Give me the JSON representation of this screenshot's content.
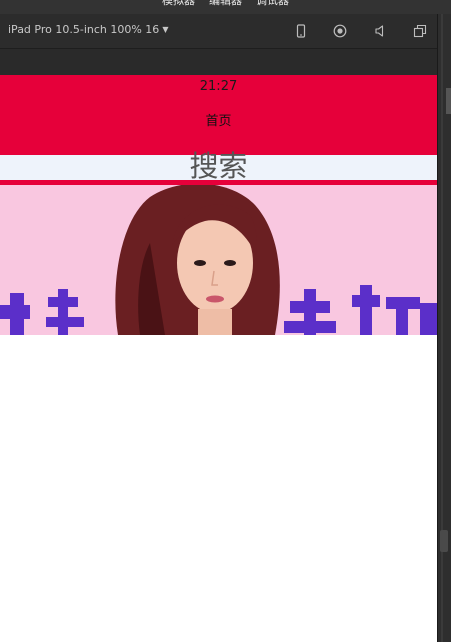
{
  "top_menu": {
    "items": [
      "模拟器",
      "编辑器",
      "调试器"
    ]
  },
  "toolbar": {
    "device_label": "iPad Pro 10.5-inch 100% 16",
    "icons": [
      "phone-icon",
      "record-icon",
      "sound-icon",
      "window-icon"
    ]
  },
  "simulator": {
    "status_time": "21:27",
    "nav_title": "首页",
    "nav_color": "#e6003a",
    "search_label": "搜索",
    "search_bg": "#eef3fb",
    "banner": {
      "background": "#f9c7e0",
      "text_color": "#5b2fc9"
    }
  }
}
